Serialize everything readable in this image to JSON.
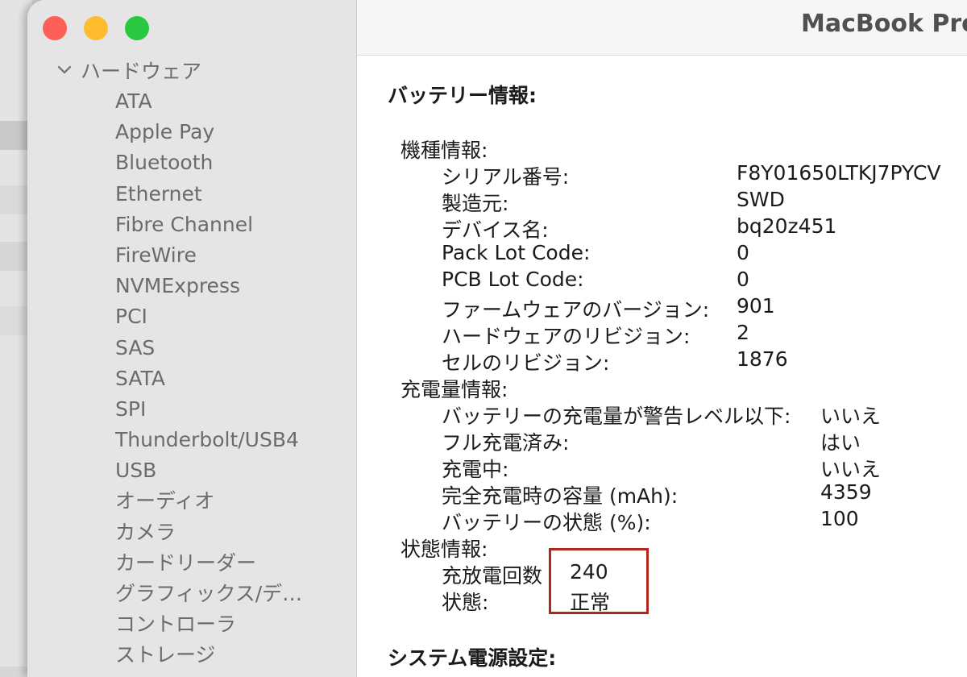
{
  "window_title": "MacBook Pro",
  "sidebar": {
    "section": "ハードウェア",
    "items": [
      "ATA",
      "Apple Pay",
      "Bluetooth",
      "Ethernet",
      "Fibre Channel",
      "FireWire",
      "NVMExpress",
      "PCI",
      "SAS",
      "SATA",
      "SPI",
      "Thunderbolt/USB4",
      "USB",
      "オーディオ",
      "カメラ",
      "カードリーダー",
      "グラフィックス/デ…",
      "コントローラ",
      "ストレージ"
    ]
  },
  "battery": {
    "heading": "バッテリー情報:",
    "model": {
      "heading": "機種情報:",
      "rows": [
        {
          "label": "シリアル番号:",
          "value": "F8Y01650LTKJ7PYCV"
        },
        {
          "label": "製造元:",
          "value": "SWD"
        },
        {
          "label": "デバイス名:",
          "value": "bq20z451"
        },
        {
          "label": "Pack Lot Code:",
          "value": "0"
        },
        {
          "label": "PCB Lot Code:",
          "value": "0"
        },
        {
          "label": "ファームウェアのバージョン:",
          "value": "901"
        },
        {
          "label": "ハードウェアのリビジョン:",
          "value": "2"
        },
        {
          "label": "セルのリビジョン:",
          "value": "1876"
        }
      ]
    },
    "charge": {
      "heading": "充電量情報:",
      "rows": [
        {
          "label": "バッテリーの充電量が警告レベル以下:",
          "value": "いいえ"
        },
        {
          "label": "フル充電済み:",
          "value": "はい"
        },
        {
          "label": "充電中:",
          "value": "いいえ"
        },
        {
          "label": "完全充電時の容量 (mAh):",
          "value": "4359"
        },
        {
          "label": "バッテリーの状態 (%):",
          "value": "100"
        }
      ]
    },
    "health": {
      "heading": "状態情報:",
      "rows": [
        {
          "label": "充放電回数",
          "value": "240"
        },
        {
          "label": "状態:",
          "value": "正常"
        }
      ]
    }
  },
  "power": {
    "heading": "システム電源設定:"
  },
  "colors": {
    "highlight": "#b3261e",
    "close": "#fe5f57",
    "minimize": "#febc2e",
    "zoom": "#28c840"
  }
}
